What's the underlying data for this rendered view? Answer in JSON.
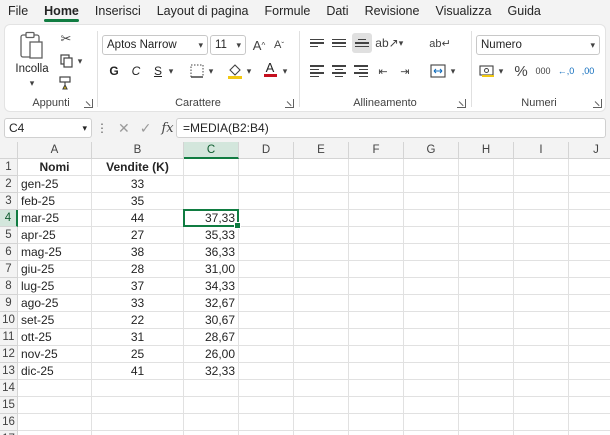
{
  "menu": {
    "tabs": [
      {
        "label": "File",
        "active": false
      },
      {
        "label": "Home",
        "active": true
      },
      {
        "label": "Inserisci",
        "active": false
      },
      {
        "label": "Layout di pagina",
        "active": false
      },
      {
        "label": "Formule",
        "active": false
      },
      {
        "label": "Dati",
        "active": false
      },
      {
        "label": "Revisione",
        "active": false
      },
      {
        "label": "Visualizza",
        "active": false
      },
      {
        "label": "Guida",
        "active": false
      }
    ]
  },
  "ribbon": {
    "clipboard": {
      "label": "Appunti",
      "paste_label": "Incolla"
    },
    "font": {
      "label": "Carattere",
      "font_name": "Aptos Narrow",
      "font_size": "11",
      "bold": "G",
      "italic": "C",
      "underline": "S"
    },
    "alignment": {
      "label": "Allineamento"
    },
    "number": {
      "label": "Numeri",
      "format": "Numero",
      "percent": "%",
      "thousands": "000",
      "increase_decimal": "←,0",
      "decrease_decimal": ",00"
    }
  },
  "formula_bar": {
    "name_box": "C4",
    "fx": "fx",
    "formula": "=MEDIA(B2:B4)"
  },
  "grid": {
    "columns": [
      "A",
      "B",
      "C",
      "D",
      "E",
      "F",
      "G",
      "H",
      "I",
      "J"
    ],
    "selected_column": "C",
    "selected_row": 4,
    "rows": [
      {
        "n": "1",
        "a": "Nomi",
        "b": "Vendite (K)",
        "c": ""
      },
      {
        "n": "2",
        "a": "gen-25",
        "b": "33",
        "c": ""
      },
      {
        "n": "3",
        "a": "feb-25",
        "b": "35",
        "c": ""
      },
      {
        "n": "4",
        "a": "mar-25",
        "b": "44",
        "c": "37,33"
      },
      {
        "n": "5",
        "a": "apr-25",
        "b": "27",
        "c": "35,33"
      },
      {
        "n": "6",
        "a": "mag-25",
        "b": "38",
        "c": "36,33"
      },
      {
        "n": "7",
        "a": "giu-25",
        "b": "28",
        "c": "31,00"
      },
      {
        "n": "8",
        "a": "lug-25",
        "b": "37",
        "c": "34,33"
      },
      {
        "n": "9",
        "a": "ago-25",
        "b": "33",
        "c": "32,67"
      },
      {
        "n": "10",
        "a": "set-25",
        "b": "22",
        "c": "30,67"
      },
      {
        "n": "11",
        "a": "ott-25",
        "b": "31",
        "c": "28,67"
      },
      {
        "n": "12",
        "a": "nov-25",
        "b": "25",
        "c": "26,00"
      },
      {
        "n": "13",
        "a": "dic-25",
        "b": "41",
        "c": "32,33"
      },
      {
        "n": "14",
        "a": "",
        "b": "",
        "c": ""
      },
      {
        "n": "15",
        "a": "",
        "b": "",
        "c": ""
      },
      {
        "n": "16",
        "a": "",
        "b": "",
        "c": ""
      },
      {
        "n": "17",
        "a": "",
        "b": "",
        "c": ""
      }
    ]
  },
  "colors": {
    "accent": "#107c41",
    "selected_header": "#d3e6dc"
  }
}
